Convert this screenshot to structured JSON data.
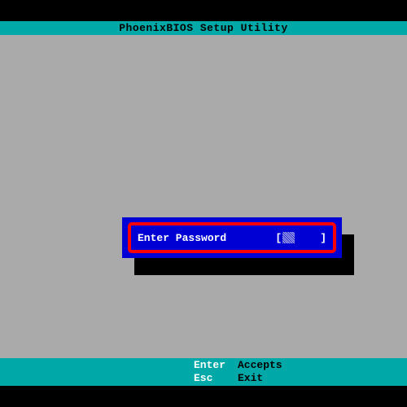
{
  "header": {
    "title": "PhoenixBIOS Setup Utility"
  },
  "dialog": {
    "label": "Enter Password",
    "bracket_open": "[",
    "bracket_close": "]",
    "value": ""
  },
  "footer": {
    "rows": [
      {
        "key": "Enter",
        "action": "Accepts"
      },
      {
        "key": "Esc",
        "action": "Exit"
      }
    ]
  },
  "colors": {
    "teal": "#00a8a8",
    "gray": "#aaa",
    "blue": "#0000d4",
    "red": "#ff0000"
  }
}
